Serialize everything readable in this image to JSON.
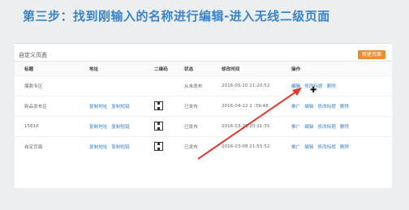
{
  "slide": {
    "title": "第三步：找到刚输入的名称进行编辑-进入无线二级页面"
  },
  "panel": {
    "title": "自定义页面",
    "new_button": "新建页面"
  },
  "table": {
    "headers": [
      "标题",
      "地址",
      "二维码",
      "状态",
      "修改时间",
      "操作"
    ],
    "rows": [
      {
        "title": "爆款专区",
        "addr": [],
        "qr": false,
        "status": "从未发布",
        "time": "2016-05-10 21:20:52",
        "actions": [
          "编辑",
          "修改标题",
          "删除"
        ]
      },
      {
        "title": "新品发布区",
        "addr": [
          "复制地址",
          "复制短链"
        ],
        "qr": true,
        "status": "已发布",
        "time": "2016-04-22 2 :39:48",
        "actions": [
          "推广",
          "编辑",
          "修改标题",
          "删除"
        ]
      },
      {
        "title": "15616",
        "addr": [
          "复制地址",
          "复制短链"
        ],
        "qr": true,
        "status": "已发布",
        "time": "2016-03-25 20:11:35",
        "actions": [
          "推广",
          "编辑",
          "修改标题",
          "删除"
        ]
      },
      {
        "title": "自定页面",
        "addr": [
          "复制地址",
          "复制短链"
        ],
        "qr": true,
        "status": "已发布",
        "time": "2016-03-08 21:55:52",
        "actions": [
          "推广",
          "编辑",
          "修改标题",
          "删除"
        ]
      }
    ]
  },
  "annotation": {
    "arrow_color": "#e03a2f"
  }
}
